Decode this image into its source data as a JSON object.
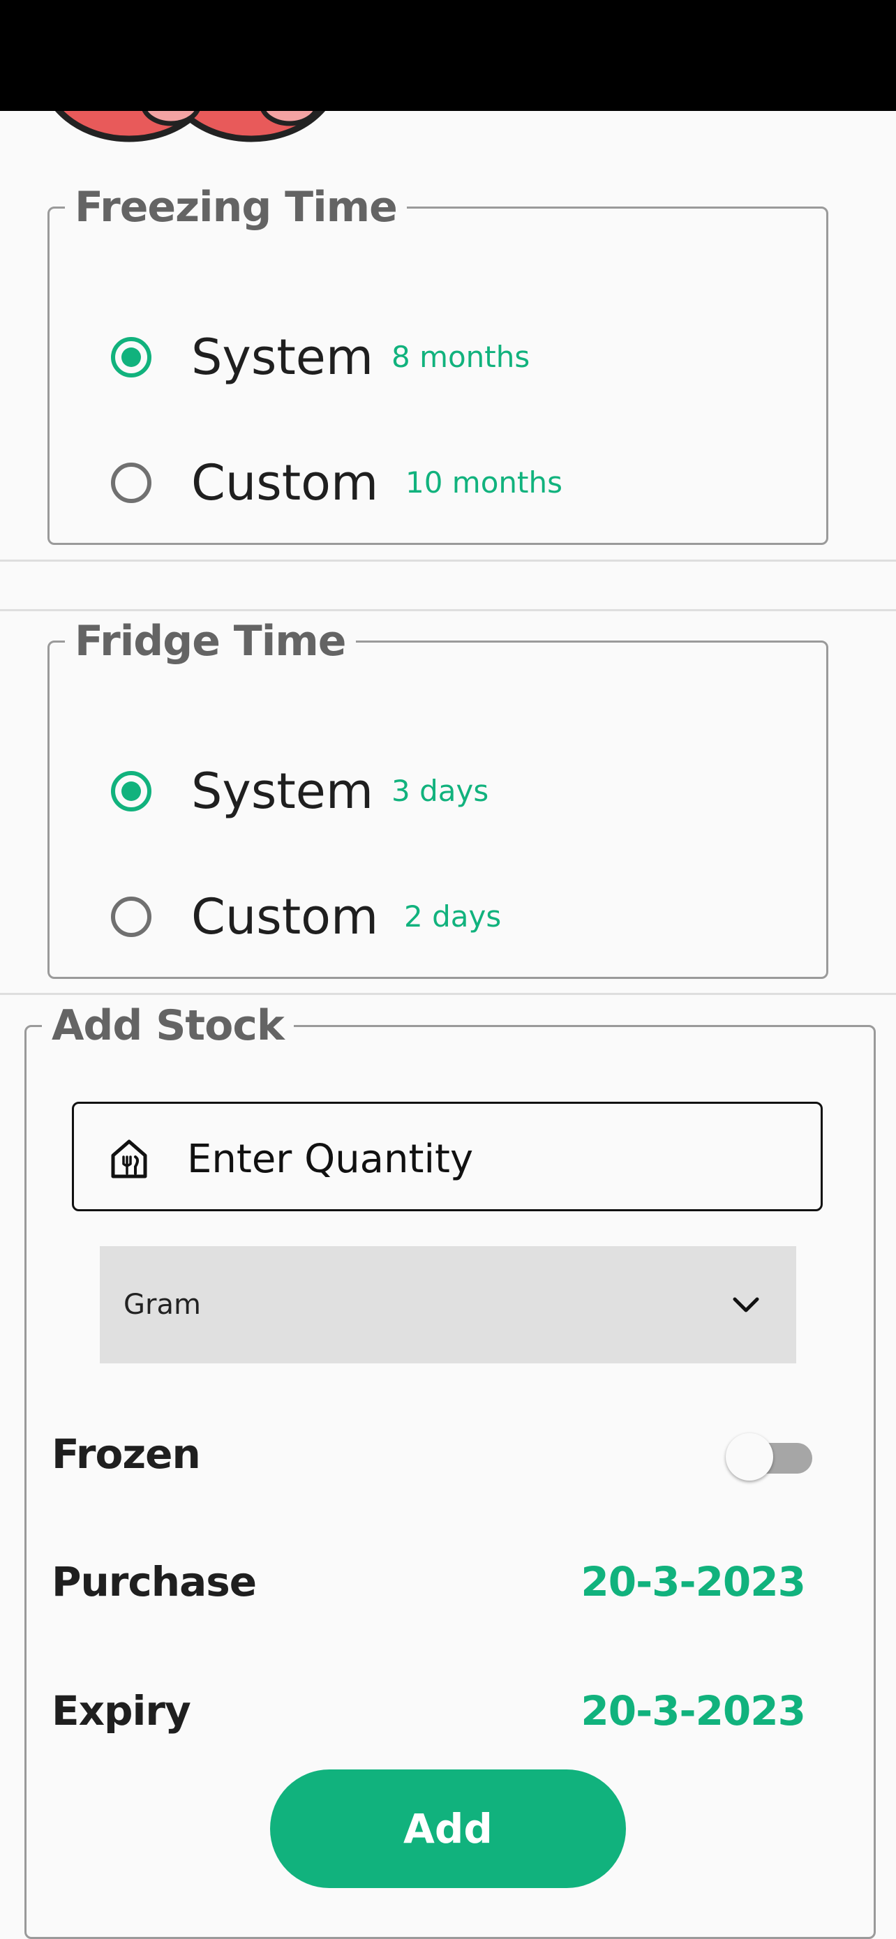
{
  "freezing": {
    "title": "Freezing Time",
    "options": [
      {
        "label": "System",
        "value": "8 months",
        "selected": true
      },
      {
        "label": "Custom",
        "value": "10 months",
        "selected": false
      }
    ]
  },
  "fridge": {
    "title": "Fridge Time",
    "options": [
      {
        "label": "System",
        "value": "3 days",
        "selected": true
      },
      {
        "label": "Custom",
        "value": "2 days",
        "selected": false
      }
    ]
  },
  "add_stock": {
    "title": "Add Stock",
    "quantity_placeholder": "Enter Quantity",
    "quantity_icon": "kitchen-icon",
    "unit_selected": "Gram",
    "frozen_label": "Frozen",
    "frozen_on": false,
    "purchase_label": "Purchase",
    "purchase_date": "20-3-2023",
    "expiry_label": "Expiry",
    "expiry_date": "20-3-2023",
    "add_button": "Add"
  },
  "colors": {
    "accent": "#11b27d",
    "topbar": "#000000",
    "border": "#9a9a9a",
    "select_bg": "#e0e0e0"
  }
}
